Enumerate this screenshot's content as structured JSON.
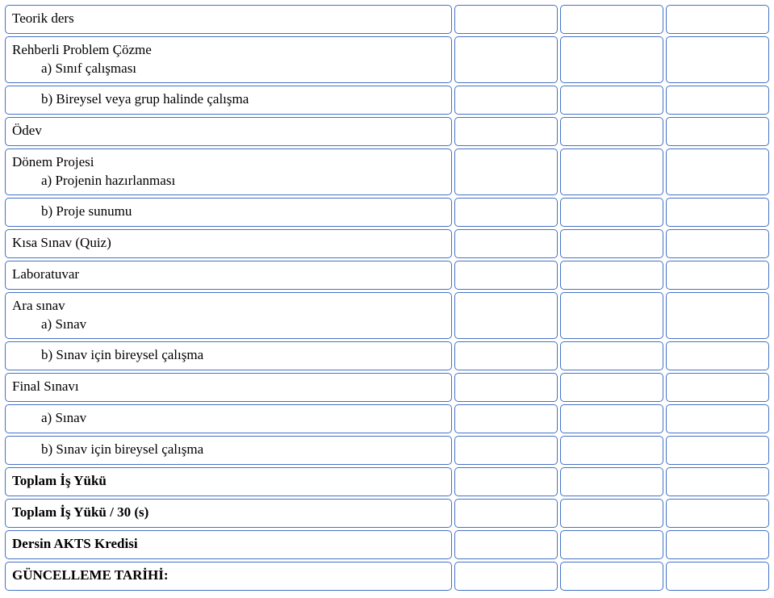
{
  "rows": [
    {
      "label_lines": [
        "Teorik ders"
      ],
      "indent": [
        false
      ]
    },
    {
      "label_lines": [
        "Rehberli Problem Çözme",
        "a)   Sınıf çalışması"
      ],
      "indent": [
        false,
        true
      ]
    },
    {
      "label_lines": [
        "b)   Bireysel veya grup halinde çalışma"
      ],
      "indent": [
        true
      ]
    },
    {
      "label_lines": [
        "Ödev"
      ],
      "indent": [
        false
      ]
    },
    {
      "label_lines": [
        "Dönem Projesi",
        "a)   Projenin hazırlanması"
      ],
      "indent": [
        false,
        true
      ]
    },
    {
      "label_lines": [
        "b)   Proje sunumu"
      ],
      "indent": [
        true
      ]
    },
    {
      "label_lines": [
        "Kısa Sınav (Quiz)"
      ],
      "indent": [
        false
      ]
    },
    {
      "label_lines": [
        "Laboratuvar"
      ],
      "indent": [
        false
      ]
    },
    {
      "label_lines": [
        "Ara sınav",
        "a)   Sınav"
      ],
      "indent": [
        false,
        true
      ]
    },
    {
      "label_lines": [
        "b)   Sınav için bireysel çalışma"
      ],
      "indent": [
        true
      ]
    },
    {
      "label_lines": [
        "Final Sınavı"
      ],
      "indent": [
        false
      ]
    },
    {
      "label_lines": [
        "a)   Sınav"
      ],
      "indent": [
        true
      ]
    },
    {
      "label_lines": [
        "b)   Sınav için bireysel çalışma"
      ],
      "indent": [
        true
      ]
    },
    {
      "label_lines": [
        "Toplam İş Yükü"
      ],
      "indent": [
        false
      ],
      "bold": true
    },
    {
      "label_lines": [
        "Toplam İş Yükü / 30 (s)"
      ],
      "indent": [
        false
      ],
      "bold": true
    },
    {
      "label_lines": [
        "Dersin AKTS Kredisi"
      ],
      "indent": [
        false
      ],
      "bold": true
    },
    {
      "label_lines": [
        "GÜNCELLEME TARİHİ:"
      ],
      "indent": [
        false
      ],
      "bold": true
    }
  ]
}
